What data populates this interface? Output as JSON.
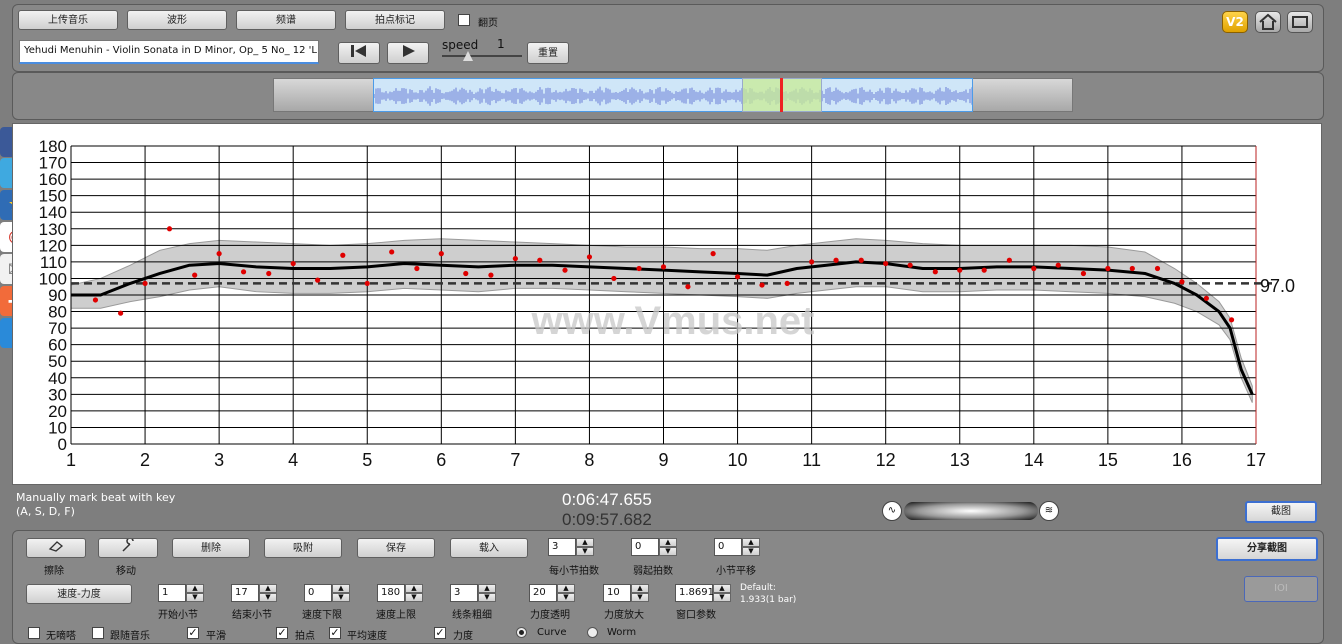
{
  "toolbar": {
    "upload_label": "上传音乐",
    "waveform_label": "波形",
    "spectrum_label": "频谱",
    "beat_mark_label": "拍点标记",
    "page_turn_label": "翻页",
    "v2_label": "V2"
  },
  "file": {
    "title": "Yehudi Menuhin - Violin Sonata in D Minor, Op_ 5 No_ 12 'L"
  },
  "playback": {
    "speed_label": "speed",
    "speed_value": "1",
    "reset_label": "重置"
  },
  "chart_data": {
    "type": "line",
    "title": "",
    "xlabel": "",
    "ylabel": "",
    "xlim": [
      1,
      17
    ],
    "ylim": [
      0,
      180
    ],
    "x_ticks": [
      "1",
      "2",
      "3",
      "4",
      "5",
      "6",
      "7",
      "8",
      "9",
      "10",
      "11",
      "12",
      "13",
      "14",
      "15",
      "16",
      "17"
    ],
    "y_ticks": [
      "0",
      "10",
      "20",
      "30",
      "40",
      "50",
      "60",
      "70",
      "80",
      "90",
      "100",
      "110",
      "120",
      "130",
      "140",
      "150",
      "160",
      "170",
      "180"
    ],
    "grid": true,
    "average_label": "97.0",
    "average_value": 97.0,
    "watermark": "www.Vmus.net",
    "series": [
      {
        "kind": "curve",
        "x": [
          1.0,
          1.4,
          1.8,
          2.2,
          2.6,
          3.0,
          3.5,
          4.0,
          4.5,
          5.0,
          5.5,
          6.0,
          6.5,
          7.0,
          7.5,
          8.0,
          8.5,
          9.0,
          9.5,
          10.0,
          10.4,
          10.8,
          11.2,
          11.6,
          12.0,
          12.5,
          13.0,
          13.5,
          14.0,
          14.5,
          15.0,
          15.5,
          15.9,
          16.2,
          16.5,
          16.65,
          16.8,
          16.95
        ],
        "y": [
          90,
          90,
          97,
          103,
          108,
          109,
          107,
          106,
          106,
          107,
          109,
          108,
          107,
          108,
          108,
          107,
          106,
          105,
          104,
          103,
          102,
          106,
          108,
          110,
          109,
          106,
          106,
          107,
          107,
          106,
          105,
          103,
          97,
          90,
          80,
          70,
          45,
          30
        ]
      },
      {
        "kind": "band_upper",
        "x": [
          1.0,
          1.4,
          1.8,
          2.2,
          2.6,
          3.0,
          3.5,
          4.0,
          4.5,
          5.0,
          5.5,
          6.0,
          6.5,
          7.0,
          7.5,
          8.0,
          8.5,
          9.0,
          9.5,
          10.0,
          10.4,
          10.8,
          11.2,
          11.6,
          12.0,
          12.5,
          13.0,
          13.5,
          14.0,
          14.5,
          15.0,
          15.5,
          15.9,
          16.2,
          16.5,
          16.65,
          16.8,
          16.95
        ],
        "y": [
          96,
          100,
          108,
          117,
          121,
          123,
          122,
          121,
          120,
          121,
          123,
          124,
          123,
          122,
          121,
          120,
          119,
          119,
          118,
          118,
          117,
          120,
          122,
          124,
          123,
          121,
          120,
          120,
          120,
          120,
          119,
          116,
          106,
          97,
          86,
          76,
          52,
          35
        ]
      },
      {
        "kind": "band_lower",
        "x": [
          1.0,
          1.4,
          1.8,
          2.2,
          2.6,
          3.0,
          3.5,
          4.0,
          4.5,
          5.0,
          5.5,
          6.0,
          6.5,
          7.0,
          7.5,
          8.0,
          8.5,
          9.0,
          9.5,
          10.0,
          10.4,
          10.8,
          11.2,
          11.6,
          12.0,
          12.5,
          13.0,
          13.5,
          14.0,
          14.5,
          15.0,
          15.5,
          15.9,
          16.2,
          16.5,
          16.65,
          16.8,
          16.95
        ],
        "y": [
          82,
          82,
          86,
          89,
          93,
          95,
          92,
          91,
          91,
          92,
          94,
          93,
          92,
          94,
          94,
          93,
          92,
          91,
          90,
          89,
          88,
          91,
          93,
          95,
          95,
          92,
          92,
          93,
          93,
          92,
          91,
          89,
          85,
          80,
          72,
          63,
          40,
          25
        ]
      },
      {
        "kind": "points",
        "x": [
          1.33,
          1.67,
          2.0,
          2.33,
          2.67,
          3.0,
          3.33,
          3.67,
          4.0,
          4.33,
          4.67,
          5.0,
          5.33,
          5.67,
          6.0,
          6.33,
          6.67,
          7.0,
          7.33,
          7.67,
          8.0,
          8.33,
          8.67,
          9.0,
          9.33,
          9.67,
          10.0,
          10.33,
          10.67,
          11.0,
          11.33,
          11.67,
          12.0,
          12.33,
          12.67,
          13.0,
          13.33,
          13.67,
          14.0,
          14.33,
          14.67,
          15.0,
          15.33,
          15.67,
          16.0,
          16.33,
          16.67
        ],
        "y": [
          87,
          79,
          97,
          130,
          102,
          115,
          104,
          103,
          109,
          99,
          114,
          97,
          116,
          106,
          115,
          103,
          102,
          112,
          111,
          105,
          113,
          100,
          106,
          107,
          95,
          115,
          101,
          96,
          97,
          110,
          111,
          111,
          109,
          108,
          104,
          105,
          105,
          111,
          106,
          108,
          103,
          106,
          106,
          106,
          98,
          88,
          75
        ]
      }
    ]
  },
  "status": {
    "hint_line1": "Manually mark beat with key",
    "hint_line2": "(A, S, D, F)",
    "current_time": "0:06:47.655",
    "total_time": "0:09:57.682",
    "screenshot_label": "截图"
  },
  "controls": {
    "erase_label": "擦除",
    "move_label": "移动",
    "delete_label": "删除",
    "snap_label": "吸附",
    "save_label": "保存",
    "load_label": "载入",
    "beats_per_bar_value": "3",
    "beats_per_bar_label": "每小节拍数",
    "pickup_value": "0",
    "pickup_label": "弱起拍数",
    "bar_shift_value": "0",
    "bar_shift_label": "小节平移",
    "share_label": "分享截图",
    "ioi_label": "IOI",
    "tempo_dyn_label": "速度-力度",
    "start_bar_value": "1",
    "start_bar_label": "开始小节",
    "end_bar_value": "17",
    "end_bar_label": "结束小节",
    "tempo_low_value": "0",
    "tempo_low_label": "速度下限",
    "tempo_high_value": "180",
    "tempo_high_label": "速度上限",
    "line_width_value": "3",
    "line_width_label": "线条粗细",
    "dyn_transp_value": "20",
    "dyn_transp_label": "力度透明",
    "dyn_zoom_value": "10",
    "dyn_zoom_label": "力度放大",
    "window_value": "1.8691",
    "window_label": "窗口参数",
    "default_line1": "Default:",
    "default_line2": "1.933(1 bar)",
    "no_metronome_label": "无嘀嗒",
    "follow_music_label": "跟随音乐",
    "smooth_label": "平滑",
    "beat_point_label": "拍点",
    "avg_tempo_label": "平均速度",
    "dynamics_label": "力度",
    "curve_label": "Curve",
    "worm_label": "Worm"
  }
}
